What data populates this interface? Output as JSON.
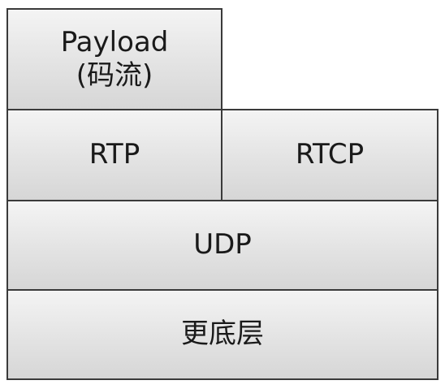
{
  "diagram": {
    "payload": {
      "line1": "Payload",
      "line2": "(码流)"
    },
    "rtp": "RTP",
    "rtcp": "RTCP",
    "udp": "UDP",
    "lower_layer": "更底层"
  }
}
